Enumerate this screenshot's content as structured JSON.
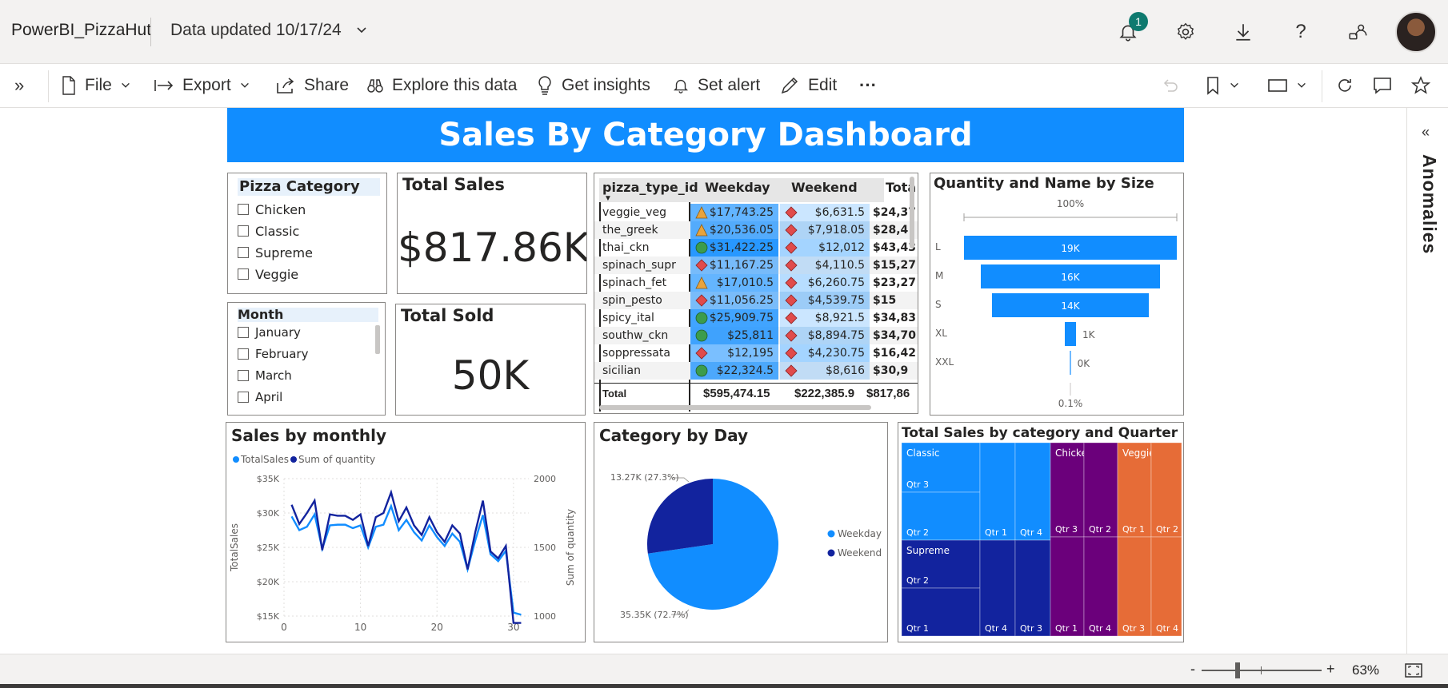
{
  "app": {
    "title": "PowerBI_PizzaHut",
    "data_updated": "Data updated 10/17/24",
    "notifications": "1"
  },
  "toolbar": {
    "file": "File",
    "export": "Export",
    "share": "Share",
    "explore": "Explore this data",
    "insights": "Get insights",
    "alert": "Set alert",
    "edit": "Edit",
    "more": "···"
  },
  "dashboard": {
    "title": "Sales By Category Dashboard"
  },
  "slicer_category": {
    "title": "Pizza Category",
    "items": [
      "Chicken",
      "Classic",
      "Supreme",
      "Veggie"
    ]
  },
  "slicer_month": {
    "title": "Month",
    "items": [
      "January",
      "February",
      "March",
      "April"
    ]
  },
  "kpi_sales": {
    "title": "Total Sales",
    "value": "$817.86K"
  },
  "kpi_sold": {
    "title": "Total Sold",
    "value": "50K"
  },
  "matrix": {
    "headers": [
      "pizza_type_id",
      "Weekday",
      "Weekend",
      "Tota"
    ],
    "rows": [
      {
        "name": "veggie_veg",
        "weekday": "$17,743.25",
        "wd_icon": "triangle",
        "weekend": "$6,631.5",
        "total": "$24,37"
      },
      {
        "name": "the_greek",
        "weekday": "$20,536.05",
        "wd_icon": "triangle",
        "weekend": "$7,918.05",
        "total": "$28,4"
      },
      {
        "name": "thai_ckn",
        "weekday": "$31,422.25",
        "wd_icon": "circle",
        "weekend": "$12,012",
        "total": "$43,43"
      },
      {
        "name": "spinach_supr",
        "weekday": "$11,167.25",
        "wd_icon": "diamond",
        "weekend": "$4,110.5",
        "total": "$15,27"
      },
      {
        "name": "spinach_fet",
        "weekday": "$17,010.5",
        "wd_icon": "triangle",
        "weekend": "$6,260.75",
        "total": "$23,27"
      },
      {
        "name": "spin_pesto",
        "weekday": "$11,056.25",
        "wd_icon": "diamond",
        "weekend": "$4,539.75",
        "total": "$15"
      },
      {
        "name": "spicy_ital",
        "weekday": "$25,909.75",
        "wd_icon": "circle",
        "weekend": "$8,921.5",
        "total": "$34,83"
      },
      {
        "name": "southw_ckn",
        "weekday": "$25,811",
        "wd_icon": "circle",
        "weekend": "$8,894.75",
        "total": "$34,70"
      },
      {
        "name": "soppressata",
        "weekday": "$12,195",
        "wd_icon": "diamond",
        "weekend": "$4,230.75",
        "total": "$16,42"
      },
      {
        "name": "sicilian",
        "weekday": "$22,324.5",
        "wd_icon": "circle",
        "weekend": "$8,616",
        "total": "$30,9"
      }
    ],
    "total": {
      "label": "Total",
      "weekday": "$595,474.15",
      "weekend": "$222,385.9",
      "total": "$817,86"
    }
  },
  "funnel": {
    "title": "Quantity and Name by Size",
    "top_label": "100%",
    "bottom_label": "0.1%",
    "chart_data": {
      "type": "funnel",
      "categories": [
        "L",
        "M",
        "S",
        "XL",
        "XXL"
      ],
      "values": [
        19000,
        16000,
        14000,
        1000,
        0
      ],
      "labels": [
        "19K",
        "16K",
        "14K",
        "1K",
        "0K"
      ]
    }
  },
  "line_chart": {
    "title": "Sales by monthly",
    "legend": [
      "TotalSales",
      "Sum of quantity"
    ],
    "ylabel_left": "TotalSales",
    "ylabel_right": "Sum of quantity",
    "yticks_left": [
      "$35K",
      "$30K",
      "$25K",
      "$20K",
      "$15K"
    ],
    "yticks_right": [
      "2000",
      "1500",
      "1000"
    ],
    "xticks": [
      "0",
      "10",
      "20",
      "30"
    ]
  },
  "pie_chart": {
    "title": "Category by Day",
    "legend": [
      "Weekday",
      "Weekend"
    ],
    "labels": [
      "13.27K (27.3%)",
      "35.35K (72.7%)"
    ]
  },
  "treemap": {
    "title": "Total Sales by category and Quarter",
    "groups": [
      "Classic",
      "Chicken",
      "Veggie",
      "Supreme"
    ]
  },
  "status": {
    "zoom": "63%",
    "minus": "-",
    "plus": "+"
  },
  "pane": {
    "anomalies": "Anomalies"
  },
  "chart_data": [
    {
      "type": "line",
      "title": "Sales by monthly",
      "x": [
        1,
        2,
        3,
        4,
        5,
        6,
        7,
        8,
        9,
        10,
        11,
        12,
        13,
        14,
        15,
        16,
        17,
        18,
        19,
        20,
        21,
        22,
        23,
        24,
        25,
        26,
        27,
        28,
        29,
        30,
        31
      ],
      "series": [
        {
          "name": "TotalSales",
          "axis": "left",
          "values": [
            29500,
            27500,
            28000,
            29800,
            24800,
            28200,
            28300,
            28300,
            27800,
            28200,
            25000,
            28000,
            28300,
            31000,
            27500,
            29000,
            27200,
            26000,
            28200,
            26500,
            25200,
            27000,
            25800,
            21800,
            26000,
            29700,
            24000,
            23000,
            24500,
            15500,
            15200
          ]
        },
        {
          "name": "Sum of quantity",
          "axis": "right",
          "values": [
            1810,
            1670,
            1750,
            1840,
            1480,
            1740,
            1730,
            1730,
            1700,
            1740,
            1510,
            1720,
            1750,
            1900,
            1690,
            1790,
            1660,
            1590,
            1720,
            1610,
            1540,
            1660,
            1600,
            1340,
            1610,
            1840,
            1470,
            1420,
            1510,
            950,
            950
          ]
        }
      ],
      "ylim_left": [
        15000,
        35000
      ],
      "ylim_right": [
        1000,
        2000
      ],
      "xlim": [
        0,
        32
      ],
      "xlabel": "",
      "ylabel": "TotalSales"
    },
    {
      "type": "pie",
      "title": "Category by Day",
      "categories": [
        "Weekday",
        "Weekend"
      ],
      "values": [
        35350,
        13270
      ],
      "colors": [
        "#118dff",
        "#12239e"
      ]
    },
    {
      "type": "funnel",
      "title": "Quantity and Name by Size",
      "categories": [
        "L",
        "M",
        "S",
        "XL",
        "XXL"
      ],
      "values": [
        19000,
        16000,
        14000,
        1000,
        0
      ]
    }
  ],
  "colors": {
    "accent": "#118dff",
    "dark": "#12239e",
    "purple": "#6b007b",
    "orange": "#e66c37",
    "green": "#3c9c4d"
  }
}
